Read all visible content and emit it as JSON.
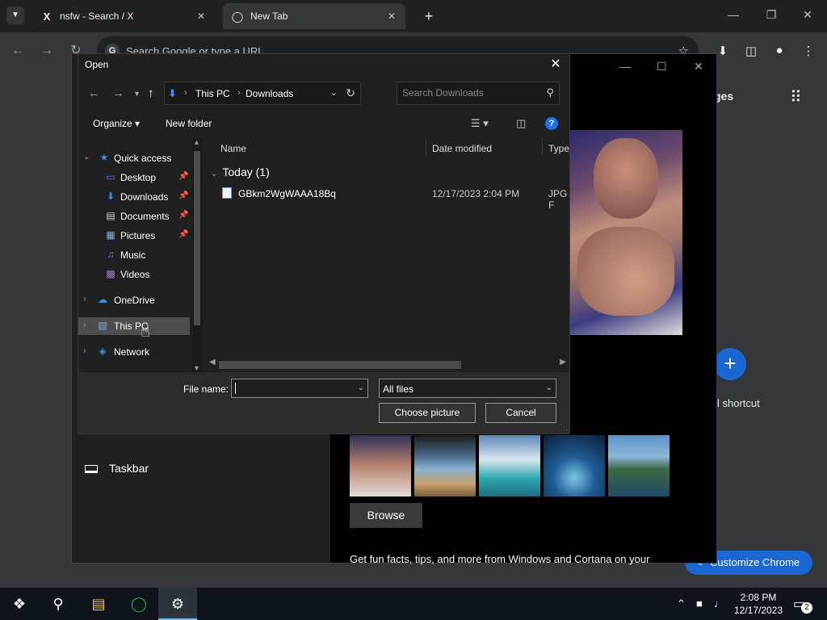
{
  "browser": {
    "tabs": [
      {
        "label": "nsfw - Search / X",
        "favicon": "X"
      },
      {
        "label": "New Tab",
        "favicon": "chrome"
      }
    ],
    "omnibox_placeholder": "Search Google or type a URL",
    "toolbar_partial_text": "ges"
  },
  "page": {
    "taskbar_setting": "Taskbar",
    "browse_label": "Browse",
    "fun_facts": "Get fun facts, tips, and more from Windows and Cortana on your",
    "add_shortcut_label": "l shortcut",
    "add_shortcut_symbol": "+",
    "customize_label": "Customize Chrome"
  },
  "dialog": {
    "title": "Open",
    "breadcrumb": [
      "This PC",
      "Downloads"
    ],
    "search_placeholder": "Search Downloads",
    "organize_label": "Organize",
    "new_folder_label": "New folder",
    "nav_items": [
      {
        "label": "Quick access",
        "icon": "star-icon",
        "pinned": false,
        "expanded": true
      },
      {
        "label": "Desktop",
        "icon": "desktop-icon",
        "pinned": true
      },
      {
        "label": "Downloads",
        "icon": "downloads-icon",
        "pinned": true
      },
      {
        "label": "Documents",
        "icon": "documents-icon",
        "pinned": true
      },
      {
        "label": "Pictures",
        "icon": "pictures-icon",
        "pinned": true
      },
      {
        "label": "Music",
        "icon": "music-icon",
        "pinned": false
      },
      {
        "label": "Videos",
        "icon": "videos-icon",
        "pinned": false
      },
      {
        "label": "OneDrive",
        "icon": "cloud-icon",
        "pinned": false
      },
      {
        "label": "This PC",
        "icon": "computer-icon",
        "pinned": false
      },
      {
        "label": "Network",
        "icon": "network-icon",
        "pinned": false
      }
    ],
    "columns": [
      "Name",
      "Date modified",
      "Type"
    ],
    "group_label": "Today (1)",
    "files": [
      {
        "name": "GBkm2WgWAAA18Bq",
        "date": "12/17/2023 2:04 PM",
        "type": "JPG F"
      }
    ],
    "file_name_label": "File name:",
    "file_name_value": "",
    "file_type": "All files",
    "choose_label": "Choose picture",
    "cancel_label": "Cancel"
  },
  "taskbar": {
    "time": "2:08 PM",
    "date": "12/17/2023",
    "notifications": "2"
  }
}
